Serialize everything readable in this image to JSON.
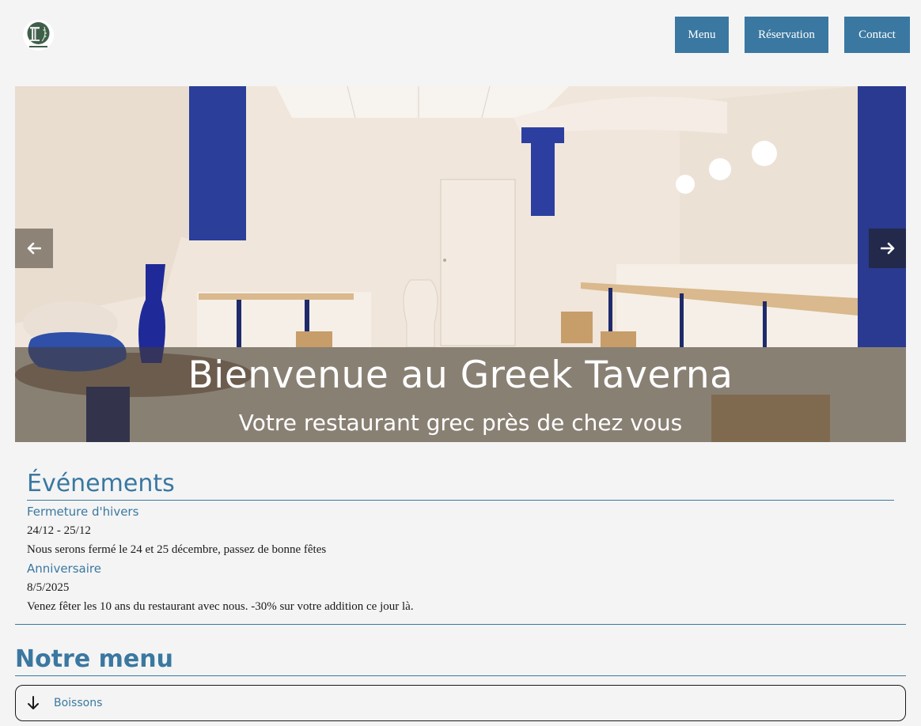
{
  "header": {
    "logo_icon": "greek-column-laurel-logo",
    "nav": {
      "menu": "Menu",
      "reservation": "Réservation",
      "contact": "Contact"
    }
  },
  "hero": {
    "title": "Bienvenue au Greek Taverna",
    "subtitle": "Votre restaurant grec près de chez vous",
    "prev_icon": "arrow-left-icon",
    "next_icon": "arrow-right-icon"
  },
  "events": {
    "title": "Événements",
    "items": [
      {
        "name": "Fermeture d'hivers",
        "date": "24/12 - 25/12",
        "description": "Nous serons fermé le 24 et 25 décembre, passez de bonne fêtes"
      },
      {
        "name": "Anniversaire",
        "date": "8/5/2025",
        "description": "Venez fêter les 10 ans du restaurant avec nous. -30% sur votre addition ce jour là."
      }
    ]
  },
  "menu": {
    "title": "Notre menu",
    "sections": [
      {
        "label": "Boissons",
        "icon": "arrow-down-icon"
      }
    ]
  },
  "colors": {
    "accent": "#3a78a1",
    "background": "#f4f4f4"
  }
}
